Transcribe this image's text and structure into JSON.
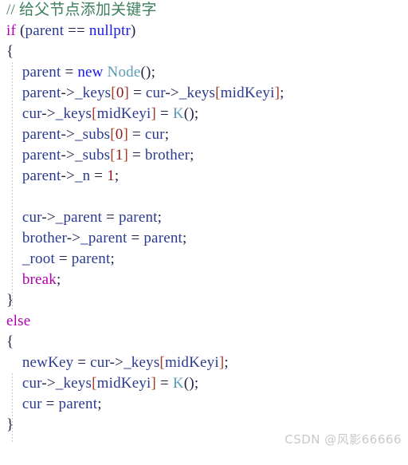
{
  "editor": {
    "language": "cpp",
    "background_color": "#ffffff",
    "indent_guide_color": "#c8c8c8",
    "line_height_px": 26,
    "font_size_px": 19
  },
  "palette": {
    "comment": "#3f7f5f",
    "keyword": "#b000b0",
    "keyword_operator": "#1a1aee",
    "type": "#5b9bb5",
    "identifier": "#2b3a8f",
    "plain": "#22224a",
    "bracket": "#a33a2a",
    "number": "#8b1a1a",
    "watermark": "#c9c9c9"
  },
  "code": {
    "lines": [
      {
        "index": 1,
        "text": "// 给父节点添加关键字",
        "tokens": [
          {
            "t": "// 给父节点添加关键字",
            "c": "comment"
          }
        ]
      },
      {
        "index": 2,
        "text": "if (parent == nullptr)",
        "tokens": [
          {
            "t": "if",
            "c": "keyword"
          },
          {
            "t": " (",
            "c": "plain"
          },
          {
            "t": "parent",
            "c": "identifier"
          },
          {
            "t": " == ",
            "c": "plain"
          },
          {
            "t": "nullptr",
            "c": "keyword_operator"
          },
          {
            "t": ")",
            "c": "plain"
          }
        ]
      },
      {
        "index": 3,
        "text": "{",
        "tokens": [
          {
            "t": "{",
            "c": "plain"
          }
        ]
      },
      {
        "index": 4,
        "text": "    parent = new Node();",
        "tokens": [
          {
            "t": "    ",
            "c": "plain"
          },
          {
            "t": "parent",
            "c": "identifier"
          },
          {
            "t": " = ",
            "c": "plain"
          },
          {
            "t": "new",
            "c": "keyword_operator"
          },
          {
            "t": " ",
            "c": "plain"
          },
          {
            "t": "Node",
            "c": "type"
          },
          {
            "t": "();",
            "c": "plain"
          }
        ]
      },
      {
        "index": 5,
        "text": "    parent->_keys[0] = cur->_keys[midKeyi];",
        "tokens": [
          {
            "t": "    ",
            "c": "plain"
          },
          {
            "t": "parent",
            "c": "identifier"
          },
          {
            "t": "->",
            "c": "plain"
          },
          {
            "t": "_keys",
            "c": "identifier"
          },
          {
            "t": "[",
            "c": "bracket"
          },
          {
            "t": "0",
            "c": "number"
          },
          {
            "t": "]",
            "c": "bracket"
          },
          {
            "t": " = ",
            "c": "plain"
          },
          {
            "t": "cur",
            "c": "identifier"
          },
          {
            "t": "->",
            "c": "plain"
          },
          {
            "t": "_keys",
            "c": "identifier"
          },
          {
            "t": "[",
            "c": "bracket"
          },
          {
            "t": "midKeyi",
            "c": "identifier"
          },
          {
            "t": "]",
            "c": "bracket"
          },
          {
            "t": ";",
            "c": "plain"
          }
        ]
      },
      {
        "index": 6,
        "text": "    cur->_keys[midKeyi] = K();",
        "tokens": [
          {
            "t": "    ",
            "c": "plain"
          },
          {
            "t": "cur",
            "c": "identifier"
          },
          {
            "t": "->",
            "c": "plain"
          },
          {
            "t": "_keys",
            "c": "identifier"
          },
          {
            "t": "[",
            "c": "bracket"
          },
          {
            "t": "midKeyi",
            "c": "identifier"
          },
          {
            "t": "]",
            "c": "bracket"
          },
          {
            "t": " = ",
            "c": "plain"
          },
          {
            "t": "K",
            "c": "type"
          },
          {
            "t": "();",
            "c": "plain"
          }
        ]
      },
      {
        "index": 7,
        "text": "    parent->_subs[0] = cur;",
        "tokens": [
          {
            "t": "    ",
            "c": "plain"
          },
          {
            "t": "parent",
            "c": "identifier"
          },
          {
            "t": "->",
            "c": "plain"
          },
          {
            "t": "_subs",
            "c": "identifier"
          },
          {
            "t": "[",
            "c": "bracket"
          },
          {
            "t": "0",
            "c": "number"
          },
          {
            "t": "]",
            "c": "bracket"
          },
          {
            "t": " = ",
            "c": "plain"
          },
          {
            "t": "cur",
            "c": "identifier"
          },
          {
            "t": ";",
            "c": "plain"
          }
        ]
      },
      {
        "index": 8,
        "text": "    parent->_subs[1] = brother;",
        "tokens": [
          {
            "t": "    ",
            "c": "plain"
          },
          {
            "t": "parent",
            "c": "identifier"
          },
          {
            "t": "->",
            "c": "plain"
          },
          {
            "t": "_subs",
            "c": "identifier"
          },
          {
            "t": "[",
            "c": "bracket"
          },
          {
            "t": "1",
            "c": "number"
          },
          {
            "t": "]",
            "c": "bracket"
          },
          {
            "t": " = ",
            "c": "plain"
          },
          {
            "t": "brother",
            "c": "identifier"
          },
          {
            "t": ";",
            "c": "plain"
          }
        ]
      },
      {
        "index": 9,
        "text": "    parent->_n = 1;",
        "tokens": [
          {
            "t": "    ",
            "c": "plain"
          },
          {
            "t": "parent",
            "c": "identifier"
          },
          {
            "t": "->",
            "c": "plain"
          },
          {
            "t": "_n",
            "c": "identifier"
          },
          {
            "t": " = ",
            "c": "plain"
          },
          {
            "t": "1",
            "c": "number"
          },
          {
            "t": ";",
            "c": "plain"
          }
        ]
      },
      {
        "index": 10,
        "text": "",
        "tokens": []
      },
      {
        "index": 11,
        "text": "    cur->_parent = parent;",
        "tokens": [
          {
            "t": "    ",
            "c": "plain"
          },
          {
            "t": "cur",
            "c": "identifier"
          },
          {
            "t": "->",
            "c": "plain"
          },
          {
            "t": "_parent",
            "c": "identifier"
          },
          {
            "t": " = ",
            "c": "plain"
          },
          {
            "t": "parent",
            "c": "identifier"
          },
          {
            "t": ";",
            "c": "plain"
          }
        ]
      },
      {
        "index": 12,
        "text": "    brother->_parent = parent;",
        "tokens": [
          {
            "t": "    ",
            "c": "plain"
          },
          {
            "t": "brother",
            "c": "identifier"
          },
          {
            "t": "->",
            "c": "plain"
          },
          {
            "t": "_parent",
            "c": "identifier"
          },
          {
            "t": " = ",
            "c": "plain"
          },
          {
            "t": "parent",
            "c": "identifier"
          },
          {
            "t": ";",
            "c": "plain"
          }
        ]
      },
      {
        "index": 13,
        "text": "    _root = parent;",
        "tokens": [
          {
            "t": "    ",
            "c": "plain"
          },
          {
            "t": "_root",
            "c": "identifier"
          },
          {
            "t": " = ",
            "c": "plain"
          },
          {
            "t": "parent",
            "c": "identifier"
          },
          {
            "t": ";",
            "c": "plain"
          }
        ]
      },
      {
        "index": 14,
        "text": "    break;",
        "tokens": [
          {
            "t": "    ",
            "c": "plain"
          },
          {
            "t": "break",
            "c": "keyword"
          },
          {
            "t": ";",
            "c": "plain"
          }
        ]
      },
      {
        "index": 15,
        "text": "}",
        "tokens": [
          {
            "t": "}",
            "c": "plain"
          }
        ]
      },
      {
        "index": 16,
        "text": "else",
        "tokens": [
          {
            "t": "else",
            "c": "keyword"
          }
        ]
      },
      {
        "index": 17,
        "text": "{",
        "tokens": [
          {
            "t": "{",
            "c": "plain"
          }
        ]
      },
      {
        "index": 18,
        "text": "    newKey = cur->_keys[midKeyi];",
        "tokens": [
          {
            "t": "    ",
            "c": "plain"
          },
          {
            "t": "newKey",
            "c": "identifier"
          },
          {
            "t": " = ",
            "c": "plain"
          },
          {
            "t": "cur",
            "c": "identifier"
          },
          {
            "t": "->",
            "c": "plain"
          },
          {
            "t": "_keys",
            "c": "identifier"
          },
          {
            "t": "[",
            "c": "bracket"
          },
          {
            "t": "midKeyi",
            "c": "identifier"
          },
          {
            "t": "]",
            "c": "bracket"
          },
          {
            "t": ";",
            "c": "plain"
          }
        ]
      },
      {
        "index": 19,
        "text": "    cur->_keys[midKeyi] = K();",
        "tokens": [
          {
            "t": "    ",
            "c": "plain"
          },
          {
            "t": "cur",
            "c": "identifier"
          },
          {
            "t": "->",
            "c": "plain"
          },
          {
            "t": "_keys",
            "c": "identifier"
          },
          {
            "t": "[",
            "c": "bracket"
          },
          {
            "t": "midKeyi",
            "c": "identifier"
          },
          {
            "t": "]",
            "c": "bracket"
          },
          {
            "t": " = ",
            "c": "plain"
          },
          {
            "t": "K",
            "c": "type"
          },
          {
            "t": "();",
            "c": "plain"
          }
        ]
      },
      {
        "index": 20,
        "text": "    cur = parent;",
        "tokens": [
          {
            "t": "    ",
            "c": "plain"
          },
          {
            "t": "cur",
            "c": "identifier"
          },
          {
            "t": " = ",
            "c": "plain"
          },
          {
            "t": "parent",
            "c": "identifier"
          },
          {
            "t": ";",
            "c": "plain"
          }
        ]
      },
      {
        "index": 21,
        "text": "}",
        "tokens": [
          {
            "t": "}",
            "c": "plain"
          }
        ]
      }
    ]
  },
  "watermark": {
    "text": "CSDN @风影66666"
  }
}
